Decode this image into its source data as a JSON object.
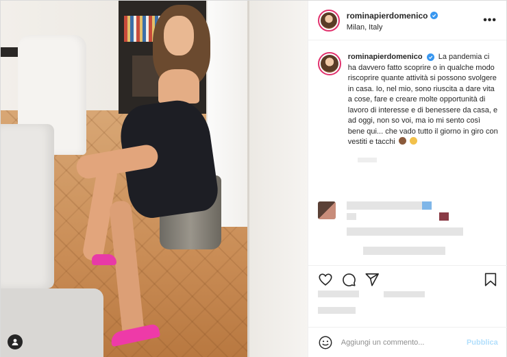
{
  "post": {
    "username": "rominapierdomenico",
    "location": "Milan, Italy",
    "more_label": "•••",
    "caption_username": "rominapierdomenico",
    "caption_text": "La pandemia ci ha davvero fatto scoprire o in qualche modo riscoprire quante attività si possono svolgere in casa. Io, nel mio, sono riuscita a dare vita a cose, fare e creare molte opportunità di lavoro di interesse e di benessere da casa, e ad oggi, non so voi, ma io mi sento così bene qui... che vado tutto il giorno in giro con vestiti e tacchi",
    "comment_placeholder": "Aggiungi un commento...",
    "publish_label": "Pubblica"
  },
  "icons": {
    "like": "heart-icon",
    "comment": "comment-icon",
    "share": "share-icon",
    "save": "bookmark-icon",
    "emoji": "smile-icon",
    "more": "more-icon",
    "verified": "verified-badge-icon",
    "tag": "user-tag-icon"
  },
  "colors": {
    "verified": "#3897f0",
    "story_ring": "#e1306c",
    "publish": "#b2dffc",
    "shoes": "#ee3aa8"
  }
}
